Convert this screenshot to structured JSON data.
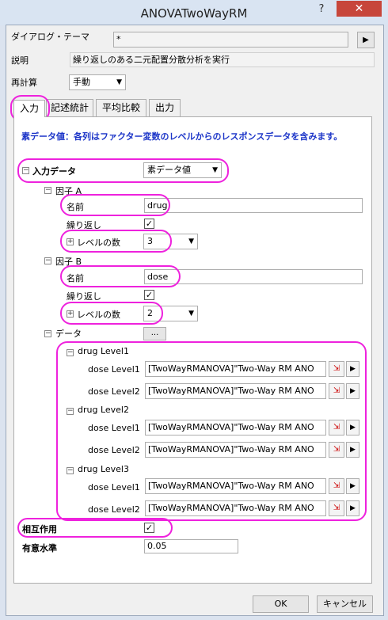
{
  "window": {
    "title": "ANOVATwoWayRM",
    "help_glyph": "?",
    "close_glyph": "✕"
  },
  "theme": {
    "label": "ダイアログ・テーマ",
    "value": "*",
    "arrow": "▶"
  },
  "description": {
    "label": "説明",
    "value": "繰り返しのある二元配置分散分析を実行"
  },
  "recalc": {
    "label": "再計算",
    "value": "手動"
  },
  "tabs": [
    "入力",
    "記述統計",
    "平均比較",
    "出力"
  ],
  "info_text": "素データ値：各列はファクター変数のレベルからのレスポンスデータを含みます。",
  "input_data": {
    "label": "入力データ",
    "value": "素データ値"
  },
  "factor_a": {
    "label": "因子 A",
    "name_label": "名前",
    "name_value": "drug",
    "repeat_label": "繰り返し",
    "levels_label": "レベルの数",
    "levels_value": "3"
  },
  "factor_b": {
    "label": "因子 B",
    "name_label": "名前",
    "name_value": "dose",
    "repeat_label": "繰り返し",
    "levels_label": "レベルの数",
    "levels_value": "2"
  },
  "data": {
    "label": "データ",
    "button": "...",
    "groups": [
      {
        "label": "drug Level1",
        "rows": [
          {
            "label": "dose Level1",
            "value": "[TwoWayRMANOVA]\"Two-Way RM ANO"
          },
          {
            "label": "dose Level2",
            "value": "[TwoWayRMANOVA]\"Two-Way RM ANO"
          }
        ]
      },
      {
        "label": "drug Level2",
        "rows": [
          {
            "label": "dose Level1",
            "value": "[TwoWayRMANOVA]\"Two-Way RM ANO"
          },
          {
            "label": "dose Level2",
            "value": "[TwoWayRMANOVA]\"Two-Way RM ANO"
          }
        ]
      },
      {
        "label": "drug Level3",
        "rows": [
          {
            "label": "dose Level1",
            "value": "[TwoWayRMANOVA]\"Two-Way RM ANO"
          },
          {
            "label": "dose Level2",
            "value": "[TwoWayRMANOVA]\"Two-Way RM ANO"
          }
        ]
      }
    ]
  },
  "interaction": {
    "label": "相互作用"
  },
  "significance": {
    "label": "有意水準",
    "value": "0.05"
  },
  "buttons": {
    "ok": "OK",
    "cancel": "キャンセル"
  },
  "check_glyph": "✓",
  "collapse_glyph": "−",
  "expand_glyph": "+",
  "dropdown_glyph": "▼",
  "row_arrow_glyph": "▶",
  "highlight_color": "#ee22dd",
  "info_color": "#1c35c8"
}
